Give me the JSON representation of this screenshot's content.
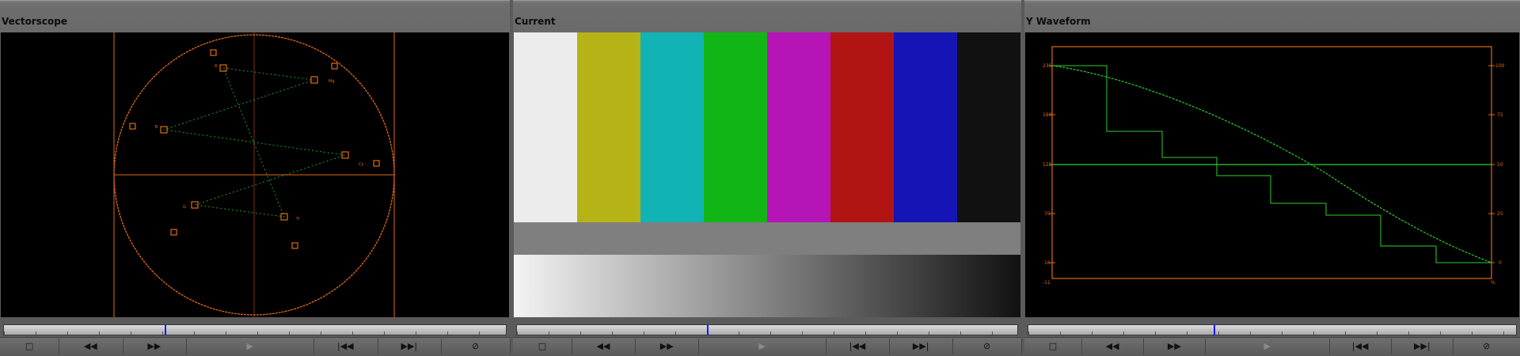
{
  "panels": [
    {
      "id": "vectorscope",
      "title": "Vectorscope",
      "playhead_fraction": 0.32
    },
    {
      "id": "current",
      "title": "Current",
      "playhead_fraction": 0.38
    },
    {
      "id": "waveform",
      "title": "Y Waveform",
      "playhead_fraction": 0.38
    }
  ],
  "controls": {
    "frame_icon": "□",
    "rewind_icon": "◀◀",
    "fast_forward_icon": "▶▶",
    "play_icon": "▶",
    "step_back_icon": "|◀◀",
    "step_forward_icon": "▶▶|",
    "no_entry_icon": "⊘"
  },
  "vectorscope": {
    "target_letters": [
      "R",
      "Mg",
      "B",
      "Cy",
      "G",
      "Yl"
    ]
  },
  "current": {
    "bar_colors": [
      "#ececec",
      "#b5b316",
      "#12b3b4",
      "#12b516",
      "#b515b6",
      "#b21414",
      "#1515b5",
      "#111111"
    ],
    "gray_strip_color": "#7f7f7f"
  },
  "waveform": {
    "left_scale": [
      "235",
      "180",
      "125",
      "70",
      "16",
      "-11"
    ],
    "right_scale": [
      "100",
      "75",
      "50",
      "25",
      "0",
      "%"
    ]
  },
  "colors": {
    "scope_orange": "#e06a14",
    "trace_green": "#2bd02b"
  }
}
